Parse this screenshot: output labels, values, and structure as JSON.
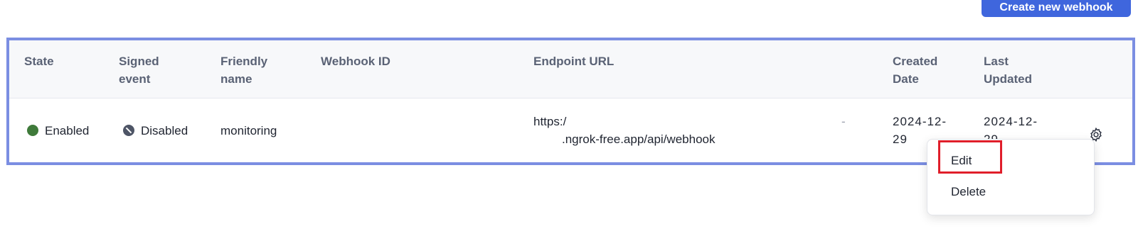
{
  "toolbar": {
    "create_label": "Create new webhook"
  },
  "table": {
    "headers": {
      "state": "State",
      "signed_event": "Signed event",
      "friendly_name": "Friendly name",
      "webhook_id": "Webhook ID",
      "endpoint_url": "Endpoint URL",
      "created_date": "Created Date",
      "last_updated": "Last Updated"
    },
    "rows": [
      {
        "state": "Enabled",
        "signed_event": "Disabled",
        "friendly_name": "monitoring",
        "webhook_id": "",
        "endpoint_url_line1": "https:/",
        "endpoint_url_line2": ".ngrok-free.app/api/webhook",
        "endpoint_url_fragment": "-",
        "created_date": "2024-12-29",
        "last_updated": "2024-12-29"
      }
    ]
  },
  "actions_menu": {
    "items": [
      "Edit",
      "Delete"
    ],
    "highlighted": "Edit"
  },
  "colors": {
    "accent": "#3f66dd",
    "frame": "#7b8ee2",
    "enabled": "#3f7a3a",
    "highlight": "#e01e2a"
  },
  "icons": {
    "settings": "gear-icon"
  }
}
